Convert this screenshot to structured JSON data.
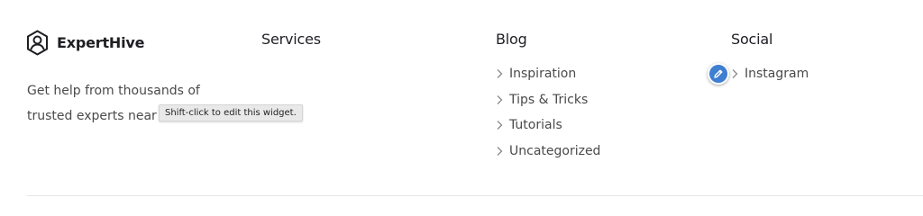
{
  "brand": {
    "name": "ExpertHive",
    "icon": "user-hexagon-icon"
  },
  "about": {
    "line1": "Get help from thousands of",
    "line2": "trusted experts near"
  },
  "tooltip": {
    "text": "Shift-click to edit this widget."
  },
  "columns": {
    "services": {
      "heading": "Services"
    },
    "blog": {
      "heading": "Blog",
      "items": [
        {
          "label": "Inspiration"
        },
        {
          "label": "Tips & Tricks"
        },
        {
          "label": "Tutorials"
        },
        {
          "label": "Uncategorized"
        }
      ]
    },
    "social": {
      "heading": "Social",
      "items": [
        {
          "label": "Instagram"
        }
      ]
    }
  },
  "edit_button": {
    "icon": "pencil-icon",
    "color": "#3f7fd1"
  },
  "colors": {
    "heading": "#1e1e24",
    "text": "#4a4a4a",
    "chevron": "#8a8a8a"
  }
}
